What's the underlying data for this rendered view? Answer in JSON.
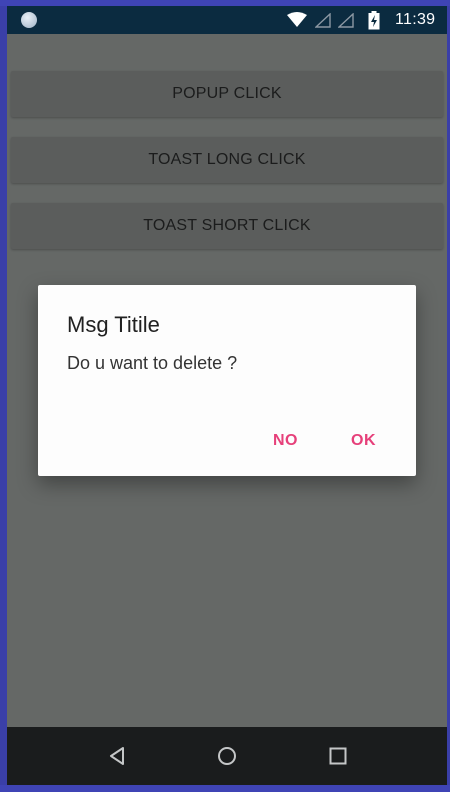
{
  "status_bar": {
    "time": "11:39",
    "icons": [
      "notification-dot-icon",
      "wifi-icon",
      "signal-icon",
      "signal-icon",
      "battery-charging-icon"
    ]
  },
  "buttons": {
    "popup": "POPUP CLICK",
    "toast_long": "TOAST LONG CLICK",
    "toast_short": "TOAST SHORT CLICK"
  },
  "dialog": {
    "title": "Msg Titile",
    "message": "Do u want to delete ?",
    "negative": "NO",
    "positive": "OK"
  },
  "nav_bar": {
    "icons": [
      "back-icon",
      "home-icon",
      "recents-icon"
    ]
  },
  "colors": {
    "accent": "#e6407a",
    "status_bar": "#0b2b40",
    "nav_bar": "#1a1c1d",
    "scrim_background": "#656866"
  }
}
